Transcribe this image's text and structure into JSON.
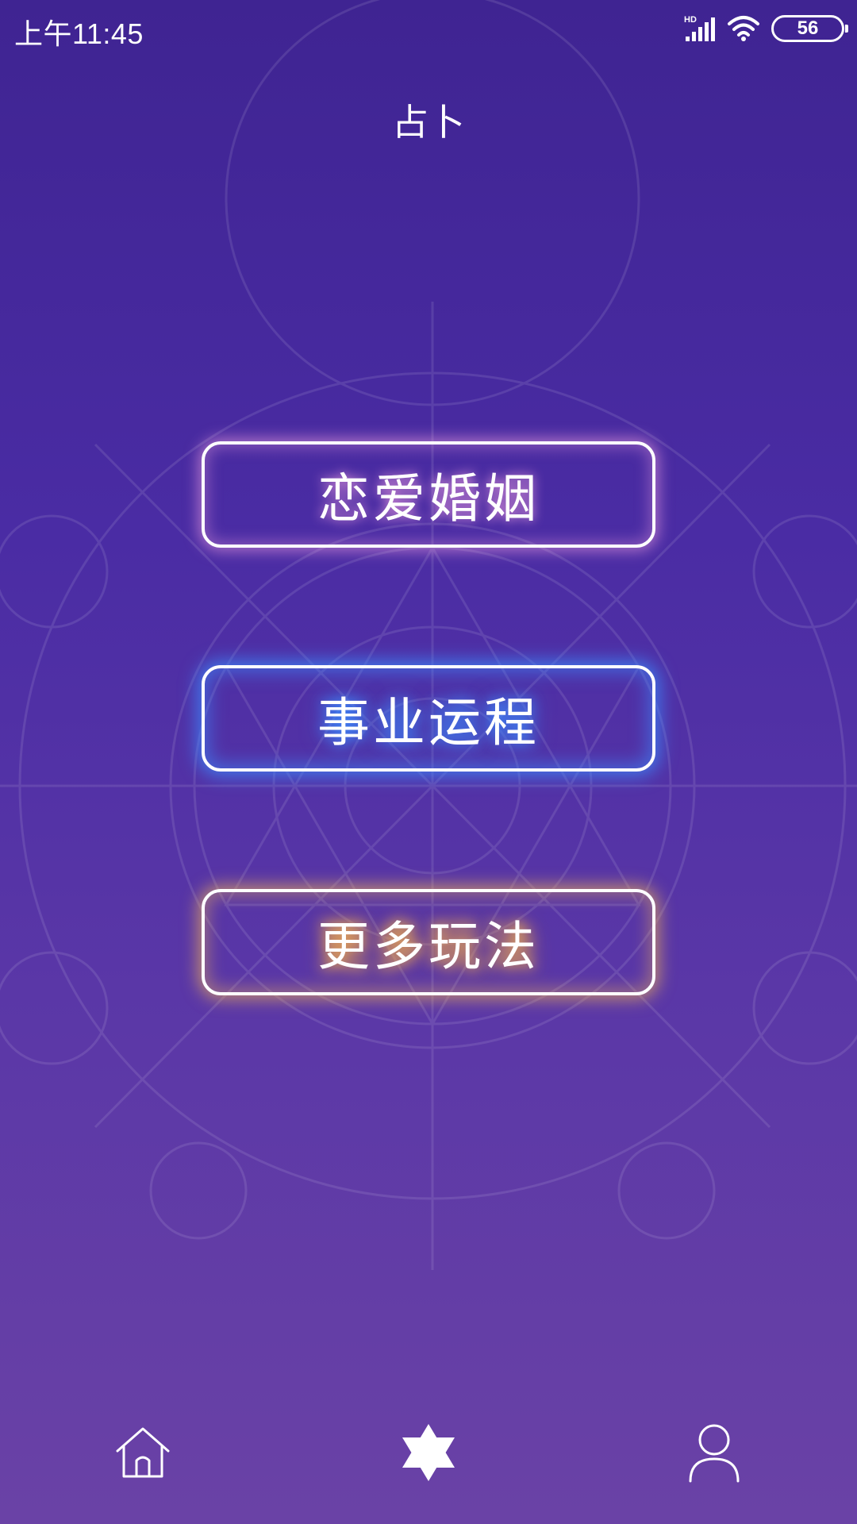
{
  "status_bar": {
    "time": "上午11:45",
    "network_label": "HD",
    "battery_level": "56"
  },
  "header": {
    "title": "占卜"
  },
  "menu": {
    "love_label": "恋爱婚姻",
    "career_label": "事业运程",
    "more_label": "更多玩法"
  },
  "colors": {
    "background_top": "#3f2492",
    "background_bottom": "#6a42a6",
    "glow_pink": "#ffaae6",
    "glow_blue": "#3c8cff",
    "glow_gold": "#ffbe50"
  },
  "bottom_nav": {
    "items": [
      {
        "icon": "home-icon",
        "active": false
      },
      {
        "icon": "star-of-david-icon",
        "active": true
      },
      {
        "icon": "user-icon",
        "active": false
      }
    ]
  }
}
